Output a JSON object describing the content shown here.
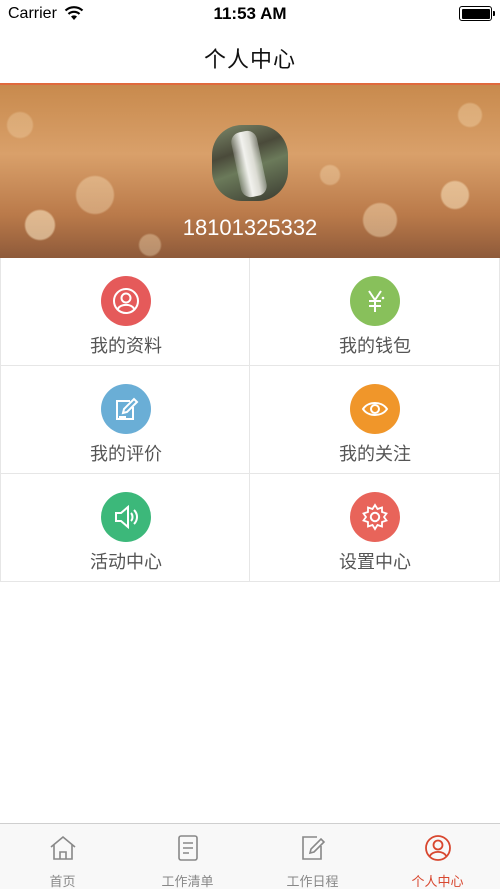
{
  "status_bar": {
    "carrier": "Carrier",
    "time": "11:53 AM"
  },
  "nav": {
    "title": "个人中心"
  },
  "profile": {
    "phone": "18101325332"
  },
  "menu": {
    "items": [
      {
        "label": "我的资料",
        "icon": "user-profile-icon",
        "color": "#e55a5a"
      },
      {
        "label": "我的钱包",
        "icon": "yen-icon",
        "color": "#88c05b"
      },
      {
        "label": "我的评价",
        "icon": "edit-review-icon",
        "color": "#6aaed6"
      },
      {
        "label": "我的关注",
        "icon": "eye-icon",
        "color": "#f0962a"
      },
      {
        "label": "活动中心",
        "icon": "speaker-icon",
        "color": "#3cb87a"
      },
      {
        "label": "设置中心",
        "icon": "gear-icon",
        "color": "#e8645a"
      }
    ]
  },
  "tabs": [
    {
      "label": "首页",
      "icon": "home-icon"
    },
    {
      "label": "工作清单",
      "icon": "list-icon"
    },
    {
      "label": "工作日程",
      "icon": "schedule-edit-icon"
    },
    {
      "label": "个人中心",
      "icon": "user-center-icon",
      "active": true
    }
  ],
  "colors": {
    "accent": "#d8472f",
    "nav_border": "#e0693d"
  }
}
